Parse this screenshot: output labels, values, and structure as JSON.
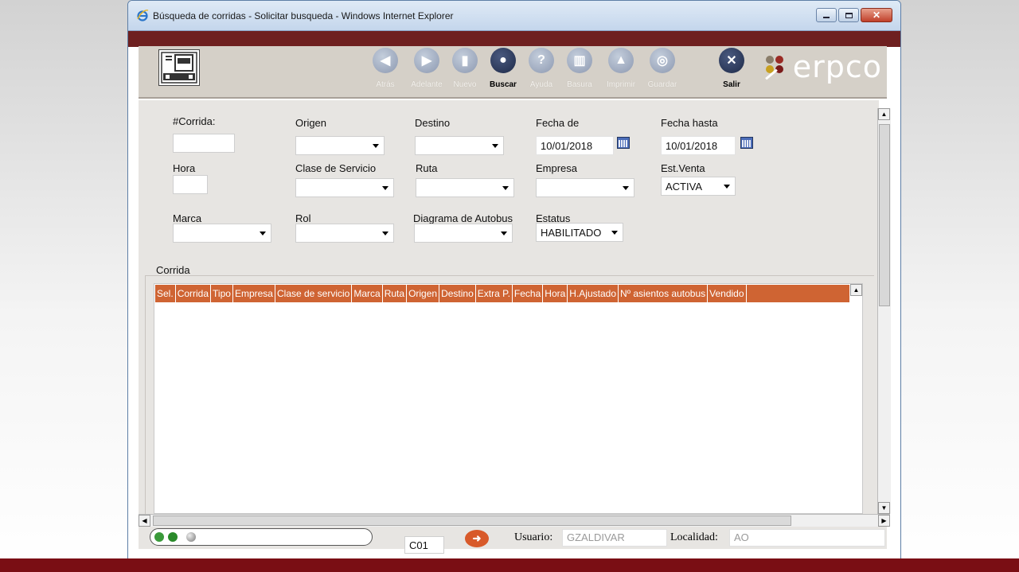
{
  "window": {
    "title": "Búsqueda de corridas - Solicitar busqueda - Windows Internet Explorer"
  },
  "toolbar": {
    "buttons": [
      {
        "label": "Atrás",
        "icon": "back-arrow-icon",
        "enabled": false
      },
      {
        "label": "Adelante",
        "icon": "forward-arrow-icon",
        "enabled": false
      },
      {
        "label": "Nuevo",
        "icon": "new-document-icon",
        "enabled": false
      },
      {
        "label": "Buscar",
        "icon": "search-icon",
        "enabled": true
      },
      {
        "label": "Ayuda",
        "icon": "help-icon",
        "enabled": false
      },
      {
        "label": "Basura",
        "icon": "trash-icon",
        "enabled": false
      },
      {
        "label": "Imprimir",
        "icon": "print-icon",
        "enabled": false
      },
      {
        "label": "Guardar",
        "icon": "save-icon",
        "enabled": false
      },
      {
        "label": "Salir",
        "icon": "exit-icon",
        "enabled": true
      }
    ],
    "logo_text": "erpco"
  },
  "form": {
    "corrida": {
      "label": "#Corrida:",
      "value": ""
    },
    "origen": {
      "label": "Origen",
      "value": ""
    },
    "destino": {
      "label": "Destino",
      "value": ""
    },
    "fecha_de": {
      "label": "Fecha de",
      "value": "10/01/2018"
    },
    "fecha_hasta": {
      "label": "Fecha hasta",
      "value": "10/01/2018"
    },
    "hora": {
      "label": "Hora",
      "value": ""
    },
    "clase_servicio": {
      "label": "Clase de Servicio",
      "value": ""
    },
    "ruta": {
      "label": "Ruta",
      "value": ""
    },
    "empresa": {
      "label": "Empresa",
      "value": ""
    },
    "est_venta": {
      "label": "Est.Venta",
      "value": "ACTIVA"
    },
    "marca": {
      "label": "Marca",
      "value": ""
    },
    "rol": {
      "label": "Rol",
      "value": ""
    },
    "diagrama": {
      "label": "Diagrama de Autobus",
      "value": ""
    },
    "estatus": {
      "label": "Estatus",
      "value": "HABILITADO"
    }
  },
  "grid": {
    "group_label": "Corrida",
    "columns": [
      "Sel.",
      "Corrida",
      "Tipo",
      "Empresa",
      "Clase de servicio",
      "Marca",
      "Ruta",
      "Origen",
      "Destino",
      "Extra P.",
      "Fecha",
      "Hora",
      "H.Ajustado",
      "Nº asientos autobus",
      "Vendido"
    ],
    "header_color": "#cf6433"
  },
  "status": {
    "terminal_value": "C01",
    "usuario_label": "Usuario:",
    "usuario_value": "GZALDIVAR",
    "localidad_label": "Localidad:",
    "localidad_value": "AO"
  },
  "colors": {
    "brand_band": "#6e2020",
    "bottom_bar": "#7a0e14"
  }
}
